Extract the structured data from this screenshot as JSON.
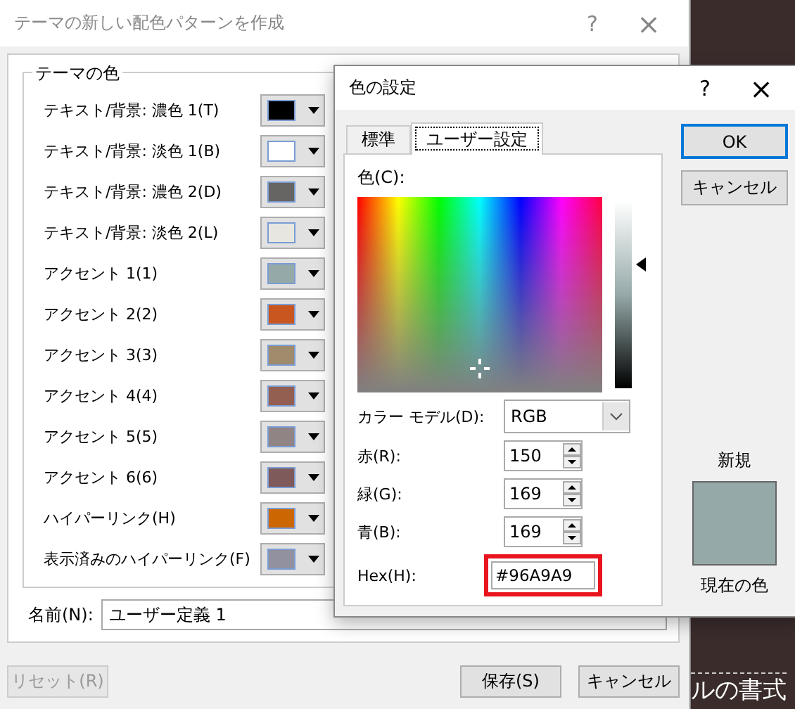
{
  "back_dialog": {
    "title": "テーマの新しい配色パターンを作成",
    "help": "?",
    "close": "×",
    "group_title": "テーマの色",
    "colors": [
      {
        "label": "テキスト/背景: 濃色 1(T)",
        "color": "#000000"
      },
      {
        "label": "テキスト/背景: 淡色 1(B)",
        "color": "#ffffff"
      },
      {
        "label": "テキスト/背景: 濃色 2(D)",
        "color": "#676464"
      },
      {
        "label": "テキスト/背景: 淡色 2(L)",
        "color": "#e8e6e1"
      },
      {
        "label": "アクセント 1(1)",
        "color": "#96a9a9"
      },
      {
        "label": "アクセント 2(2)",
        "color": "#c8561e"
      },
      {
        "label": "アクセント 3(3)",
        "color": "#a08b6c"
      },
      {
        "label": "アクセント 4(4)",
        "color": "#935f50"
      },
      {
        "label": "アクセント 5(5)",
        "color": "#918485"
      },
      {
        "label": "アクセント 6(6)",
        "color": "#7f5a5a"
      },
      {
        "label": "ハイパーリンク(H)",
        "color": "#cc6600"
      },
      {
        "label": "表示済みのハイパーリンク(F)",
        "color": "#9191a0"
      }
    ],
    "name_label": "名前(N):",
    "name_value": "ユーザー定義 1",
    "buttons": [
      {
        "label": "リセット(R)",
        "disabled": true
      },
      {
        "label": "保存(S)",
        "disabled": false
      },
      {
        "label": "キャンセル",
        "disabled": false
      }
    ]
  },
  "background_text": "ルの書式",
  "color_dialog": {
    "title": "色の設定",
    "help": "?",
    "close": "×",
    "tabs": [
      {
        "label": "標準",
        "selected": false
      },
      {
        "label": "ユーザー設定",
        "selected": true
      }
    ],
    "color_label": "色(C):",
    "model_label": "カラー モデル(D):",
    "model_value": "RGB",
    "channels": [
      {
        "label": "赤(R):",
        "value": "150"
      },
      {
        "label": "緑(G):",
        "value": "169"
      },
      {
        "label": "青(B):",
        "value": "169"
      }
    ],
    "hex_label": "Hex(H):",
    "hex_value": "#96A9A9",
    "hex_highlighted": true,
    "ok": "OK",
    "cancel": "キャンセル",
    "new_label": "新規",
    "current_label": "現在の色"
  }
}
